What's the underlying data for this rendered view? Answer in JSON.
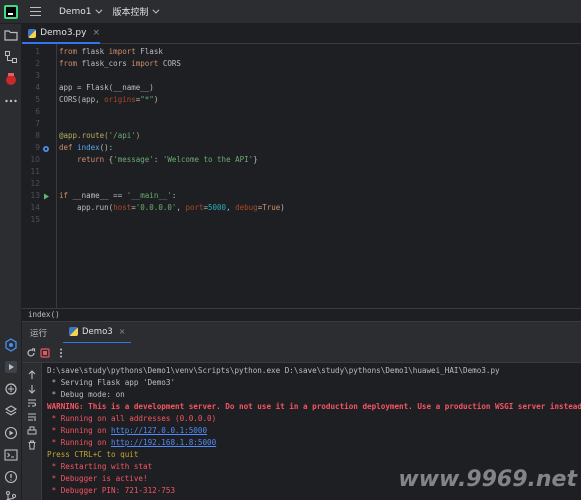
{
  "titlebar": {
    "project": "Demo1",
    "vcs": "版本控制"
  },
  "tabs": [
    {
      "label": "Demo3.py",
      "close": "×"
    }
  ],
  "line_numbers": [
    "1",
    "2",
    "3",
    "4",
    "5",
    "6",
    "7",
    "8",
    "9",
    "10",
    "11",
    "12",
    "13",
    "14",
    "15"
  ],
  "breadcrumb": "index()",
  "run_panel": {
    "label": "运行",
    "tab": "Demo3",
    "close": "×"
  },
  "console": [
    "D:\\save\\study\\pythons\\Demo1\\venv\\Scripts\\python.exe D:\\save\\study\\pythons\\Demo1\\huawei_HAI\\Demo3.py",
    " * Serving Flask app 'Demo3'",
    " * Debug mode: on",
    "WARNING: This is a development server. Do not use it in a production deployment. Use a production WSGI server instead.",
    " * Running on all addresses (0.0.0.0)",
    " * Running on ",
    "http://127.0.0.1:5000",
    " * Running on ",
    "http://192.168.1.8:5000",
    "Press CTRL+C to quit",
    " * Restarting with stat",
    " * Debugger is active!",
    " * Debugger PIN: 721-312-753"
  ],
  "watermark": "www.9969.net",
  "colors": {
    "accent": "#3574f0",
    "background": "#1e1f22",
    "panel": "#2b2d30"
  }
}
